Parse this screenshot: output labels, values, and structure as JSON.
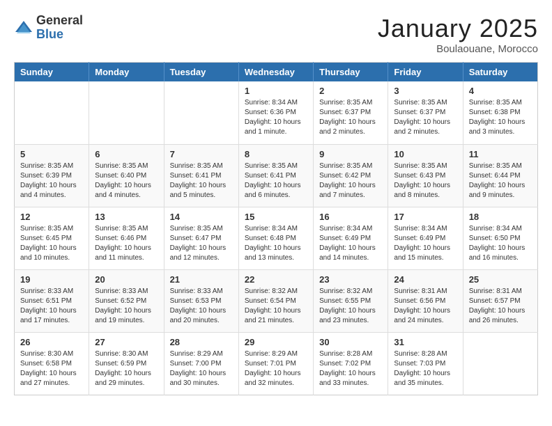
{
  "header": {
    "logo_general": "General",
    "logo_blue": "Blue",
    "month_title": "January 2025",
    "subtitle": "Boulaouane, Morocco"
  },
  "days_of_week": [
    "Sunday",
    "Monday",
    "Tuesday",
    "Wednesday",
    "Thursday",
    "Friday",
    "Saturday"
  ],
  "weeks": [
    [
      {
        "day": "",
        "info": ""
      },
      {
        "day": "",
        "info": ""
      },
      {
        "day": "",
        "info": ""
      },
      {
        "day": "1",
        "info": "Sunrise: 8:34 AM\nSunset: 6:36 PM\nDaylight: 10 hours and 1 minute."
      },
      {
        "day": "2",
        "info": "Sunrise: 8:35 AM\nSunset: 6:37 PM\nDaylight: 10 hours and 2 minutes."
      },
      {
        "day": "3",
        "info": "Sunrise: 8:35 AM\nSunset: 6:37 PM\nDaylight: 10 hours and 2 minutes."
      },
      {
        "day": "4",
        "info": "Sunrise: 8:35 AM\nSunset: 6:38 PM\nDaylight: 10 hours and 3 minutes."
      }
    ],
    [
      {
        "day": "5",
        "info": "Sunrise: 8:35 AM\nSunset: 6:39 PM\nDaylight: 10 hours and 4 minutes."
      },
      {
        "day": "6",
        "info": "Sunrise: 8:35 AM\nSunset: 6:40 PM\nDaylight: 10 hours and 4 minutes."
      },
      {
        "day": "7",
        "info": "Sunrise: 8:35 AM\nSunset: 6:41 PM\nDaylight: 10 hours and 5 minutes."
      },
      {
        "day": "8",
        "info": "Sunrise: 8:35 AM\nSunset: 6:41 PM\nDaylight: 10 hours and 6 minutes."
      },
      {
        "day": "9",
        "info": "Sunrise: 8:35 AM\nSunset: 6:42 PM\nDaylight: 10 hours and 7 minutes."
      },
      {
        "day": "10",
        "info": "Sunrise: 8:35 AM\nSunset: 6:43 PM\nDaylight: 10 hours and 8 minutes."
      },
      {
        "day": "11",
        "info": "Sunrise: 8:35 AM\nSunset: 6:44 PM\nDaylight: 10 hours and 9 minutes."
      }
    ],
    [
      {
        "day": "12",
        "info": "Sunrise: 8:35 AM\nSunset: 6:45 PM\nDaylight: 10 hours and 10 minutes."
      },
      {
        "day": "13",
        "info": "Sunrise: 8:35 AM\nSunset: 6:46 PM\nDaylight: 10 hours and 11 minutes."
      },
      {
        "day": "14",
        "info": "Sunrise: 8:35 AM\nSunset: 6:47 PM\nDaylight: 10 hours and 12 minutes."
      },
      {
        "day": "15",
        "info": "Sunrise: 8:34 AM\nSunset: 6:48 PM\nDaylight: 10 hours and 13 minutes."
      },
      {
        "day": "16",
        "info": "Sunrise: 8:34 AM\nSunset: 6:49 PM\nDaylight: 10 hours and 14 minutes."
      },
      {
        "day": "17",
        "info": "Sunrise: 8:34 AM\nSunset: 6:49 PM\nDaylight: 10 hours and 15 minutes."
      },
      {
        "day": "18",
        "info": "Sunrise: 8:34 AM\nSunset: 6:50 PM\nDaylight: 10 hours and 16 minutes."
      }
    ],
    [
      {
        "day": "19",
        "info": "Sunrise: 8:33 AM\nSunset: 6:51 PM\nDaylight: 10 hours and 17 minutes."
      },
      {
        "day": "20",
        "info": "Sunrise: 8:33 AM\nSunset: 6:52 PM\nDaylight: 10 hours and 19 minutes."
      },
      {
        "day": "21",
        "info": "Sunrise: 8:33 AM\nSunset: 6:53 PM\nDaylight: 10 hours and 20 minutes."
      },
      {
        "day": "22",
        "info": "Sunrise: 8:32 AM\nSunset: 6:54 PM\nDaylight: 10 hours and 21 minutes."
      },
      {
        "day": "23",
        "info": "Sunrise: 8:32 AM\nSunset: 6:55 PM\nDaylight: 10 hours and 23 minutes."
      },
      {
        "day": "24",
        "info": "Sunrise: 8:31 AM\nSunset: 6:56 PM\nDaylight: 10 hours and 24 minutes."
      },
      {
        "day": "25",
        "info": "Sunrise: 8:31 AM\nSunset: 6:57 PM\nDaylight: 10 hours and 26 minutes."
      }
    ],
    [
      {
        "day": "26",
        "info": "Sunrise: 8:30 AM\nSunset: 6:58 PM\nDaylight: 10 hours and 27 minutes."
      },
      {
        "day": "27",
        "info": "Sunrise: 8:30 AM\nSunset: 6:59 PM\nDaylight: 10 hours and 29 minutes."
      },
      {
        "day": "28",
        "info": "Sunrise: 8:29 AM\nSunset: 7:00 PM\nDaylight: 10 hours and 30 minutes."
      },
      {
        "day": "29",
        "info": "Sunrise: 8:29 AM\nSunset: 7:01 PM\nDaylight: 10 hours and 32 minutes."
      },
      {
        "day": "30",
        "info": "Sunrise: 8:28 AM\nSunset: 7:02 PM\nDaylight: 10 hours and 33 minutes."
      },
      {
        "day": "31",
        "info": "Sunrise: 8:28 AM\nSunset: 7:03 PM\nDaylight: 10 hours and 35 minutes."
      },
      {
        "day": "",
        "info": ""
      }
    ]
  ]
}
